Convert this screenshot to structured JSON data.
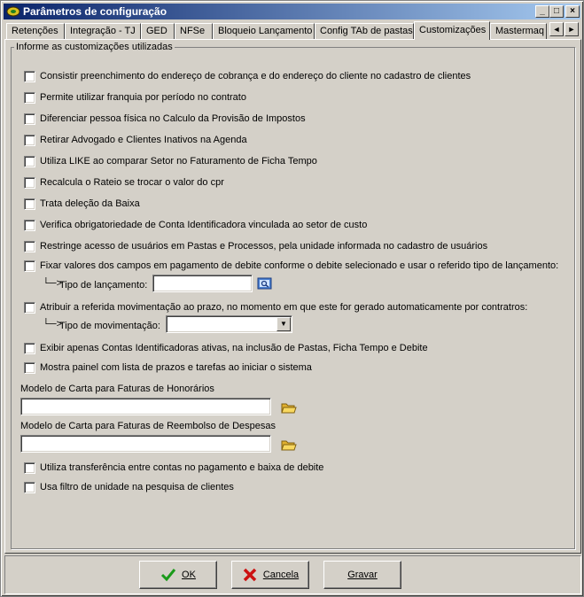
{
  "window": {
    "title": "Parâmetros de configuração"
  },
  "titlebar_buttons": {
    "minimize": "_",
    "maximize": "□",
    "close": "×"
  },
  "tabs": [
    {
      "label": "Retenções"
    },
    {
      "label": "Integração - TJ"
    },
    {
      "label": "GED"
    },
    {
      "label": "NFSe"
    },
    {
      "label": "Bloqueio Lançamento"
    },
    {
      "label": "Config TAb de pastas"
    },
    {
      "label": "Customizações",
      "active": true
    },
    {
      "label": "Mastermaq"
    }
  ],
  "tab_scroll": {
    "left": "◄",
    "right": "►"
  },
  "group": {
    "label": "Informe as customizações utilizadas"
  },
  "options": [
    {
      "label": "Consistir preenchimento do endereço de cobrança e do endereço do cliente no cadastro de clientes",
      "checked": false
    },
    {
      "label": "Permite utilizar franquia por período no contrato",
      "checked": false
    },
    {
      "label": "Diferenciar pessoa física no Calculo da Provisão de Impostos",
      "checked": false
    },
    {
      "label": "Retirar Advogado e Clientes Inativos na Agenda",
      "checked": false
    },
    {
      "label": "Utiliza LIKE ao comparar Setor no Faturamento de Ficha Tempo",
      "checked": false
    },
    {
      "label": "Recalcula o Rateio se trocar o valor do cpr",
      "checked": false
    },
    {
      "label": "Trata deleção da Baixa",
      "checked": false
    },
    {
      "label": "Verifica obrigatoriedade de Conta Identificadora vinculada ao setor de custo",
      "checked": false
    },
    {
      "label": "Restringe acesso de usuários em Pastas e Processos, pela unidade informada no cadastro de usuários",
      "checked": false
    },
    {
      "label": "Fixar valores dos campos em pagamento de debite conforme o debite selecionado e usar o referido tipo de lançamento:",
      "checked": false
    },
    {
      "label": "Atribuir a referida movimentação ao prazo, no momento em que este for gerado automaticamente por contratros:",
      "checked": false
    },
    {
      "label": "Exibir apenas Contas Identificadoras ativas, na inclusão de Pastas, Ficha Tempo e Debite",
      "checked": false
    },
    {
      "label": "Mostra painel com lista de prazos e tarefas ao iniciar o sistema",
      "checked": false
    },
    {
      "label": "Utiliza transferência entre contas no pagamento e baixa de debite",
      "checked": false
    },
    {
      "label": "Usa filtro de unidade na pesquisa de clientes",
      "checked": false
    }
  ],
  "sub_fields": {
    "tipo_lancamento": {
      "arrow": "└─>",
      "label": "Tipo de lançamento:",
      "value": ""
    },
    "tipo_movimentacao": {
      "arrow": "└─>",
      "label": "Tipo de movimentação:",
      "value": ""
    }
  },
  "modelo_honorarios": {
    "label": "Modelo de Carta para Faturas de Honorários",
    "value": ""
  },
  "modelo_reembolso": {
    "label": "Modelo de Carta para Faturas de Reembolso de Despesas",
    "value": ""
  },
  "buttons": {
    "ok": "OK",
    "cancel": "Cancela",
    "save": "Gravar"
  },
  "colors": {
    "title_start": "#0a246a",
    "title_end": "#a6caf0",
    "face": "#d4d0c8",
    "ok_green": "#1a9a1a",
    "cancel_red": "#cc1111"
  }
}
